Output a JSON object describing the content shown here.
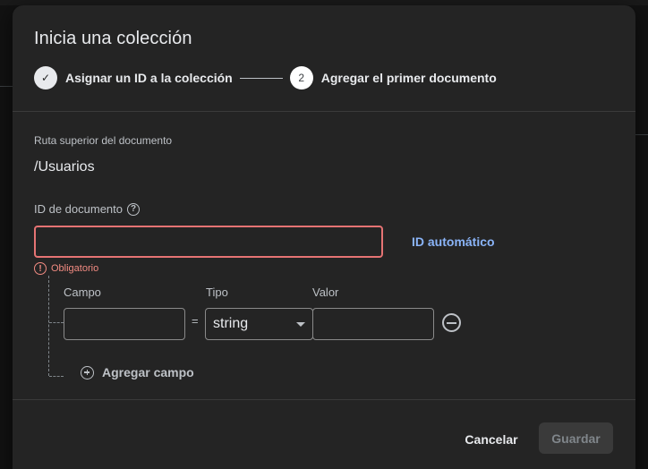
{
  "dialog": {
    "title": "Inicia una colección"
  },
  "stepper": {
    "steps": [
      {
        "label": "Asignar un ID a la colección",
        "state": "done",
        "marker": "✓"
      },
      {
        "label": "Agregar el primer documento",
        "state": "active",
        "marker": "2"
      }
    ]
  },
  "parent_path": {
    "label": "Ruta superior del documento",
    "value": "/Usuarios"
  },
  "document_id": {
    "label": "ID de documento",
    "value": "",
    "auto_id_label": "ID automático",
    "error_text": "Obligatorio"
  },
  "fields": {
    "col_field": "Campo",
    "col_type": "Tipo",
    "col_value": "Valor",
    "equals": "=",
    "rows": [
      {
        "field": "",
        "type": "string",
        "value": ""
      }
    ],
    "add_label": "Agregar campo"
  },
  "actions": {
    "cancel": "Cancelar",
    "save": "Guardar"
  },
  "icons": {
    "help": "help-icon",
    "error": "error-icon",
    "remove": "remove-circle-icon",
    "add": "add-circle-icon",
    "dropdown": "chevron-down-icon",
    "check": "check-icon"
  },
  "colors": {
    "dialog_bg": "#242424",
    "error": "#f28b82",
    "link": "#8ab4f8"
  }
}
